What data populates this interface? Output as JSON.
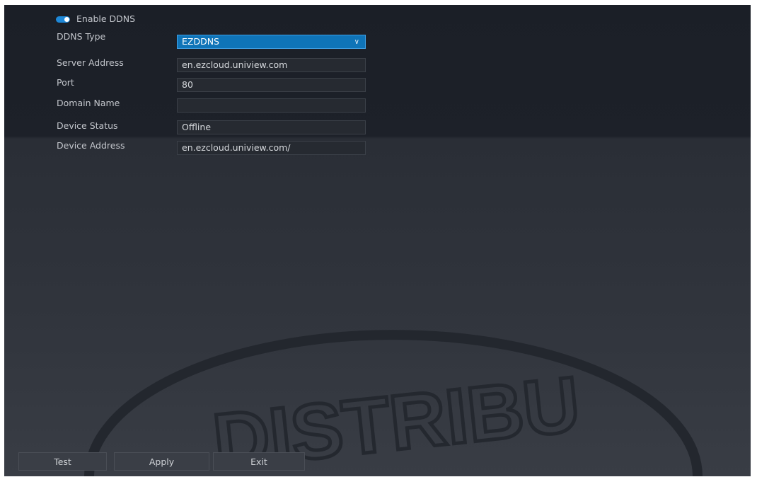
{
  "form": {
    "enable_ddns_label": "Enable DDNS",
    "enable_ddns_on": true,
    "fields": [
      {
        "label": "DDNS Type",
        "value": "EZDDNS"
      },
      {
        "label": "Server Address",
        "value": "en.ezcloud.uniview.com"
      },
      {
        "label": "Port",
        "value": "80"
      },
      {
        "label": "Domain Name",
        "value": ""
      },
      {
        "label": "Device Status",
        "value": "Offline"
      },
      {
        "label": "Device Address",
        "value": "en.ezcloud.uniview.com/"
      }
    ]
  },
  "buttons": {
    "test": "Test",
    "apply": "Apply",
    "exit": "Exit"
  },
  "icons": {
    "dropdown": "chevron-down-icon",
    "toggle": "toggle-switch-icon"
  },
  "watermark_text": "DISTRIBU",
  "colors": {
    "accent": "#1e88d8",
    "dropdown_bg": "#0f74b8",
    "panel": "#1d2129"
  }
}
